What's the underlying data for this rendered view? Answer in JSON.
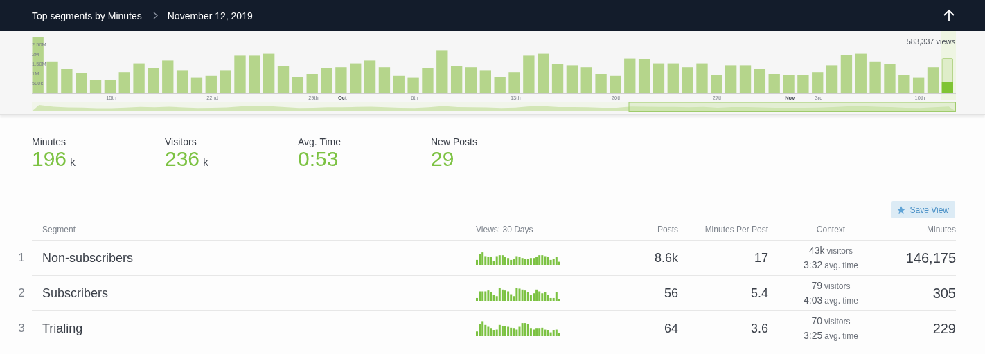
{
  "header": {
    "title": "Top segments by Minutes",
    "breadcrumb": "November 12, 2019"
  },
  "chart": {
    "total_label": "583,337 views",
    "today": {
      "level": 0.32
    },
    "chart_data": {
      "type": "bar",
      "categories": [
        null,
        null,
        null,
        null,
        null,
        "15th",
        null,
        null,
        null,
        null,
        null,
        null,
        "22nd",
        null,
        null,
        null,
        null,
        null,
        null,
        "29th",
        null,
        "Oct",
        null,
        null,
        null,
        null,
        "6th",
        null,
        null,
        null,
        null,
        null,
        null,
        "13th",
        null,
        null,
        null,
        null,
        null,
        null,
        "20th",
        null,
        null,
        null,
        null,
        null,
        null,
        "27th",
        null,
        null,
        null,
        null,
        "Nov",
        null,
        "3rd",
        null,
        null,
        null,
        null,
        null,
        null,
        "10th",
        null,
        null
      ],
      "values": [
        2900000,
        1650000,
        1250000,
        1050000,
        700000,
        700000,
        1100000,
        1550000,
        1300000,
        1700000,
        1200000,
        800000,
        900000,
        1200000,
        1950000,
        1950000,
        2050000,
        1400000,
        850000,
        1000000,
        1300000,
        1350000,
        1550000,
        1700000,
        1350000,
        900000,
        800000,
        1300000,
        2200000,
        1400000,
        1350000,
        1200000,
        850000,
        1100000,
        1950000,
        2050000,
        1500000,
        1450000,
        1350000,
        1000000,
        900000,
        1800000,
        1750000,
        1550000,
        1550000,
        1350000,
        1550000,
        950000,
        1450000,
        1450000,
        1250000,
        1000000,
        950000,
        950000,
        1100000,
        1450000,
        2000000,
        2050000,
        1650000,
        1500000,
        950000,
        800000,
        1350000,
        1820000
      ],
      "ylim": [
        0,
        3000000
      ],
      "yticks": [
        {
          "value": 500000,
          "label": "500k"
        },
        {
          "value": 1000000,
          "label": "1M"
        },
        {
          "value": 1500000,
          "label": "1.50M"
        },
        {
          "value": 2000000,
          "label": "2M"
        },
        {
          "value": 2500000,
          "label": "2.50M"
        }
      ]
    }
  },
  "stats": [
    {
      "label": "Minutes",
      "value": "196",
      "unit": "k"
    },
    {
      "label": "Visitors",
      "value": "236",
      "unit": "k"
    },
    {
      "label": "Avg. Time",
      "value": "0:53"
    },
    {
      "label": "New Posts",
      "value": "29"
    }
  ],
  "save_button": {
    "label": "Save View"
  },
  "table": {
    "columns": [
      "Segment",
      "Views: 30 Days",
      "Posts",
      "Minutes Per Post",
      "Context",
      "Minutes"
    ],
    "rows": [
      {
        "rank": "1",
        "segment": "Non-subscribers",
        "posts": "8.6k",
        "minutes_per_post": "17",
        "context": [
          {
            "value": "43k",
            "unit": "visitors"
          },
          {
            "value": "3:32",
            "unit": "avg. time"
          }
        ],
        "minutes": "146,175"
      },
      {
        "rank": "2",
        "segment": "Subscribers",
        "posts": "56",
        "minutes_per_post": "5.4",
        "context": [
          {
            "value": "79",
            "unit": "visitors"
          },
          {
            "value": "4:03",
            "unit": "avg. time"
          }
        ],
        "minutes": "305"
      },
      {
        "rank": "3",
        "segment": "Trialing",
        "posts": "64",
        "minutes_per_post": "3.6",
        "context": [
          {
            "value": "70",
            "unit": "visitors"
          },
          {
            "value": "3:25",
            "unit": "avg. time"
          }
        ],
        "minutes": "229"
      }
    ]
  }
}
